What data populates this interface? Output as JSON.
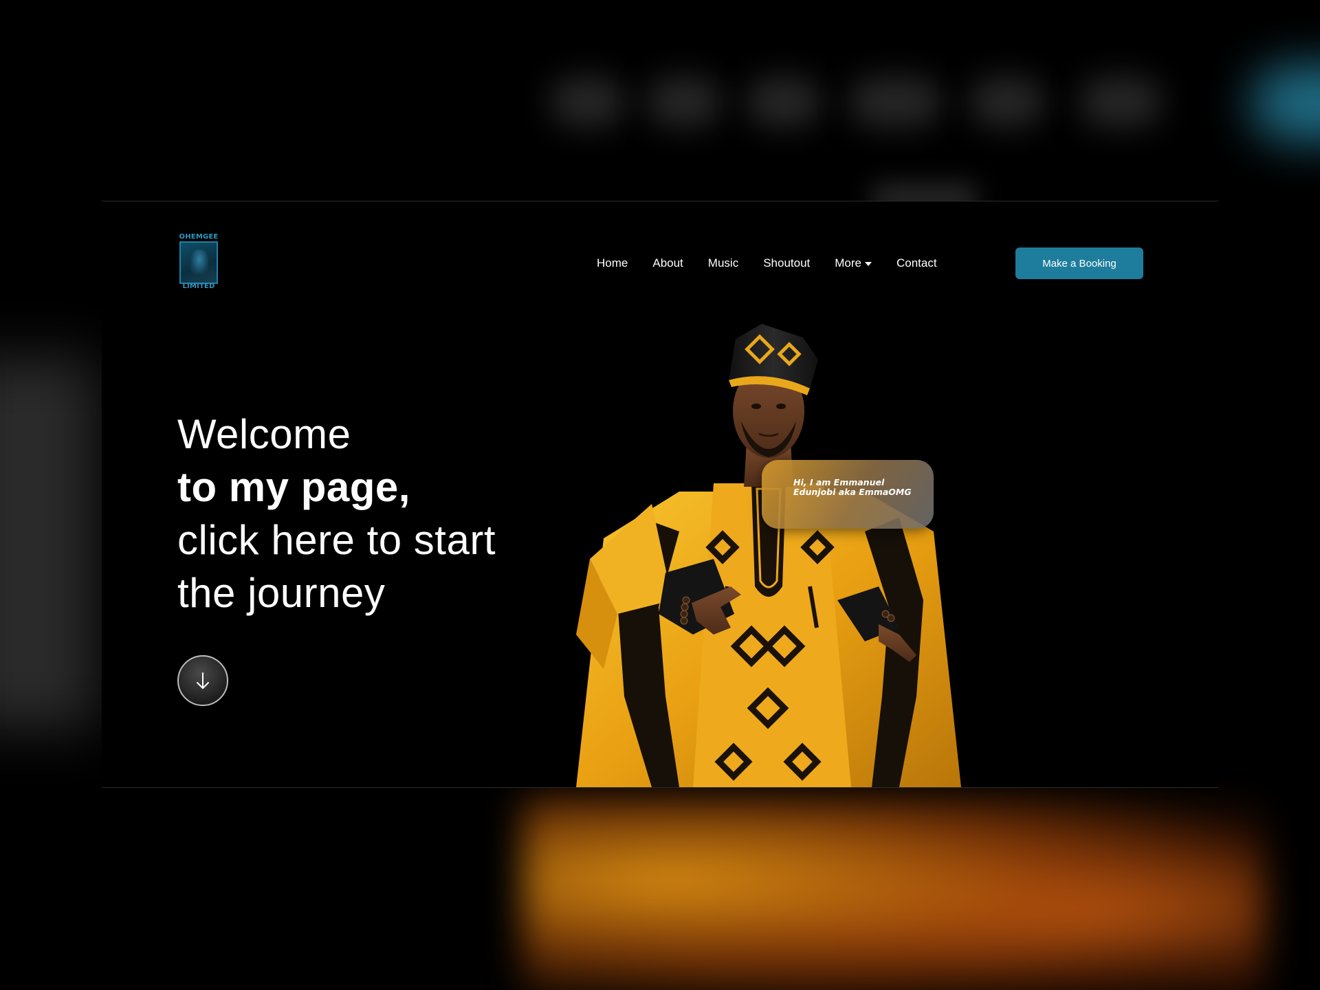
{
  "logo": {
    "top_text": "OHEMGEE",
    "bottom_text": "LIMITED"
  },
  "nav": {
    "items": [
      {
        "label": "Home"
      },
      {
        "label": "About"
      },
      {
        "label": "Music"
      },
      {
        "label": "Shoutout"
      },
      {
        "label": "More",
        "has_dropdown": true
      },
      {
        "label": "Contact"
      }
    ],
    "cta_label": "Make a Booking"
  },
  "hero": {
    "line1": "Welcome",
    "line2": "to my page,",
    "line3": "click here to start",
    "line4": "the journey"
  },
  "speech": {
    "text": "Hi, I am Emmanuel Edunjobi aka EmmaOMG"
  },
  "colors": {
    "accent": "#1e7d9c",
    "logo": "#2f97c0",
    "agbada_gold": "#f2b01e",
    "background": "#000000",
    "text": "#ffffff"
  },
  "icons": {
    "scroll": "arrow-down-icon",
    "dropdown": "caret-down-icon"
  }
}
